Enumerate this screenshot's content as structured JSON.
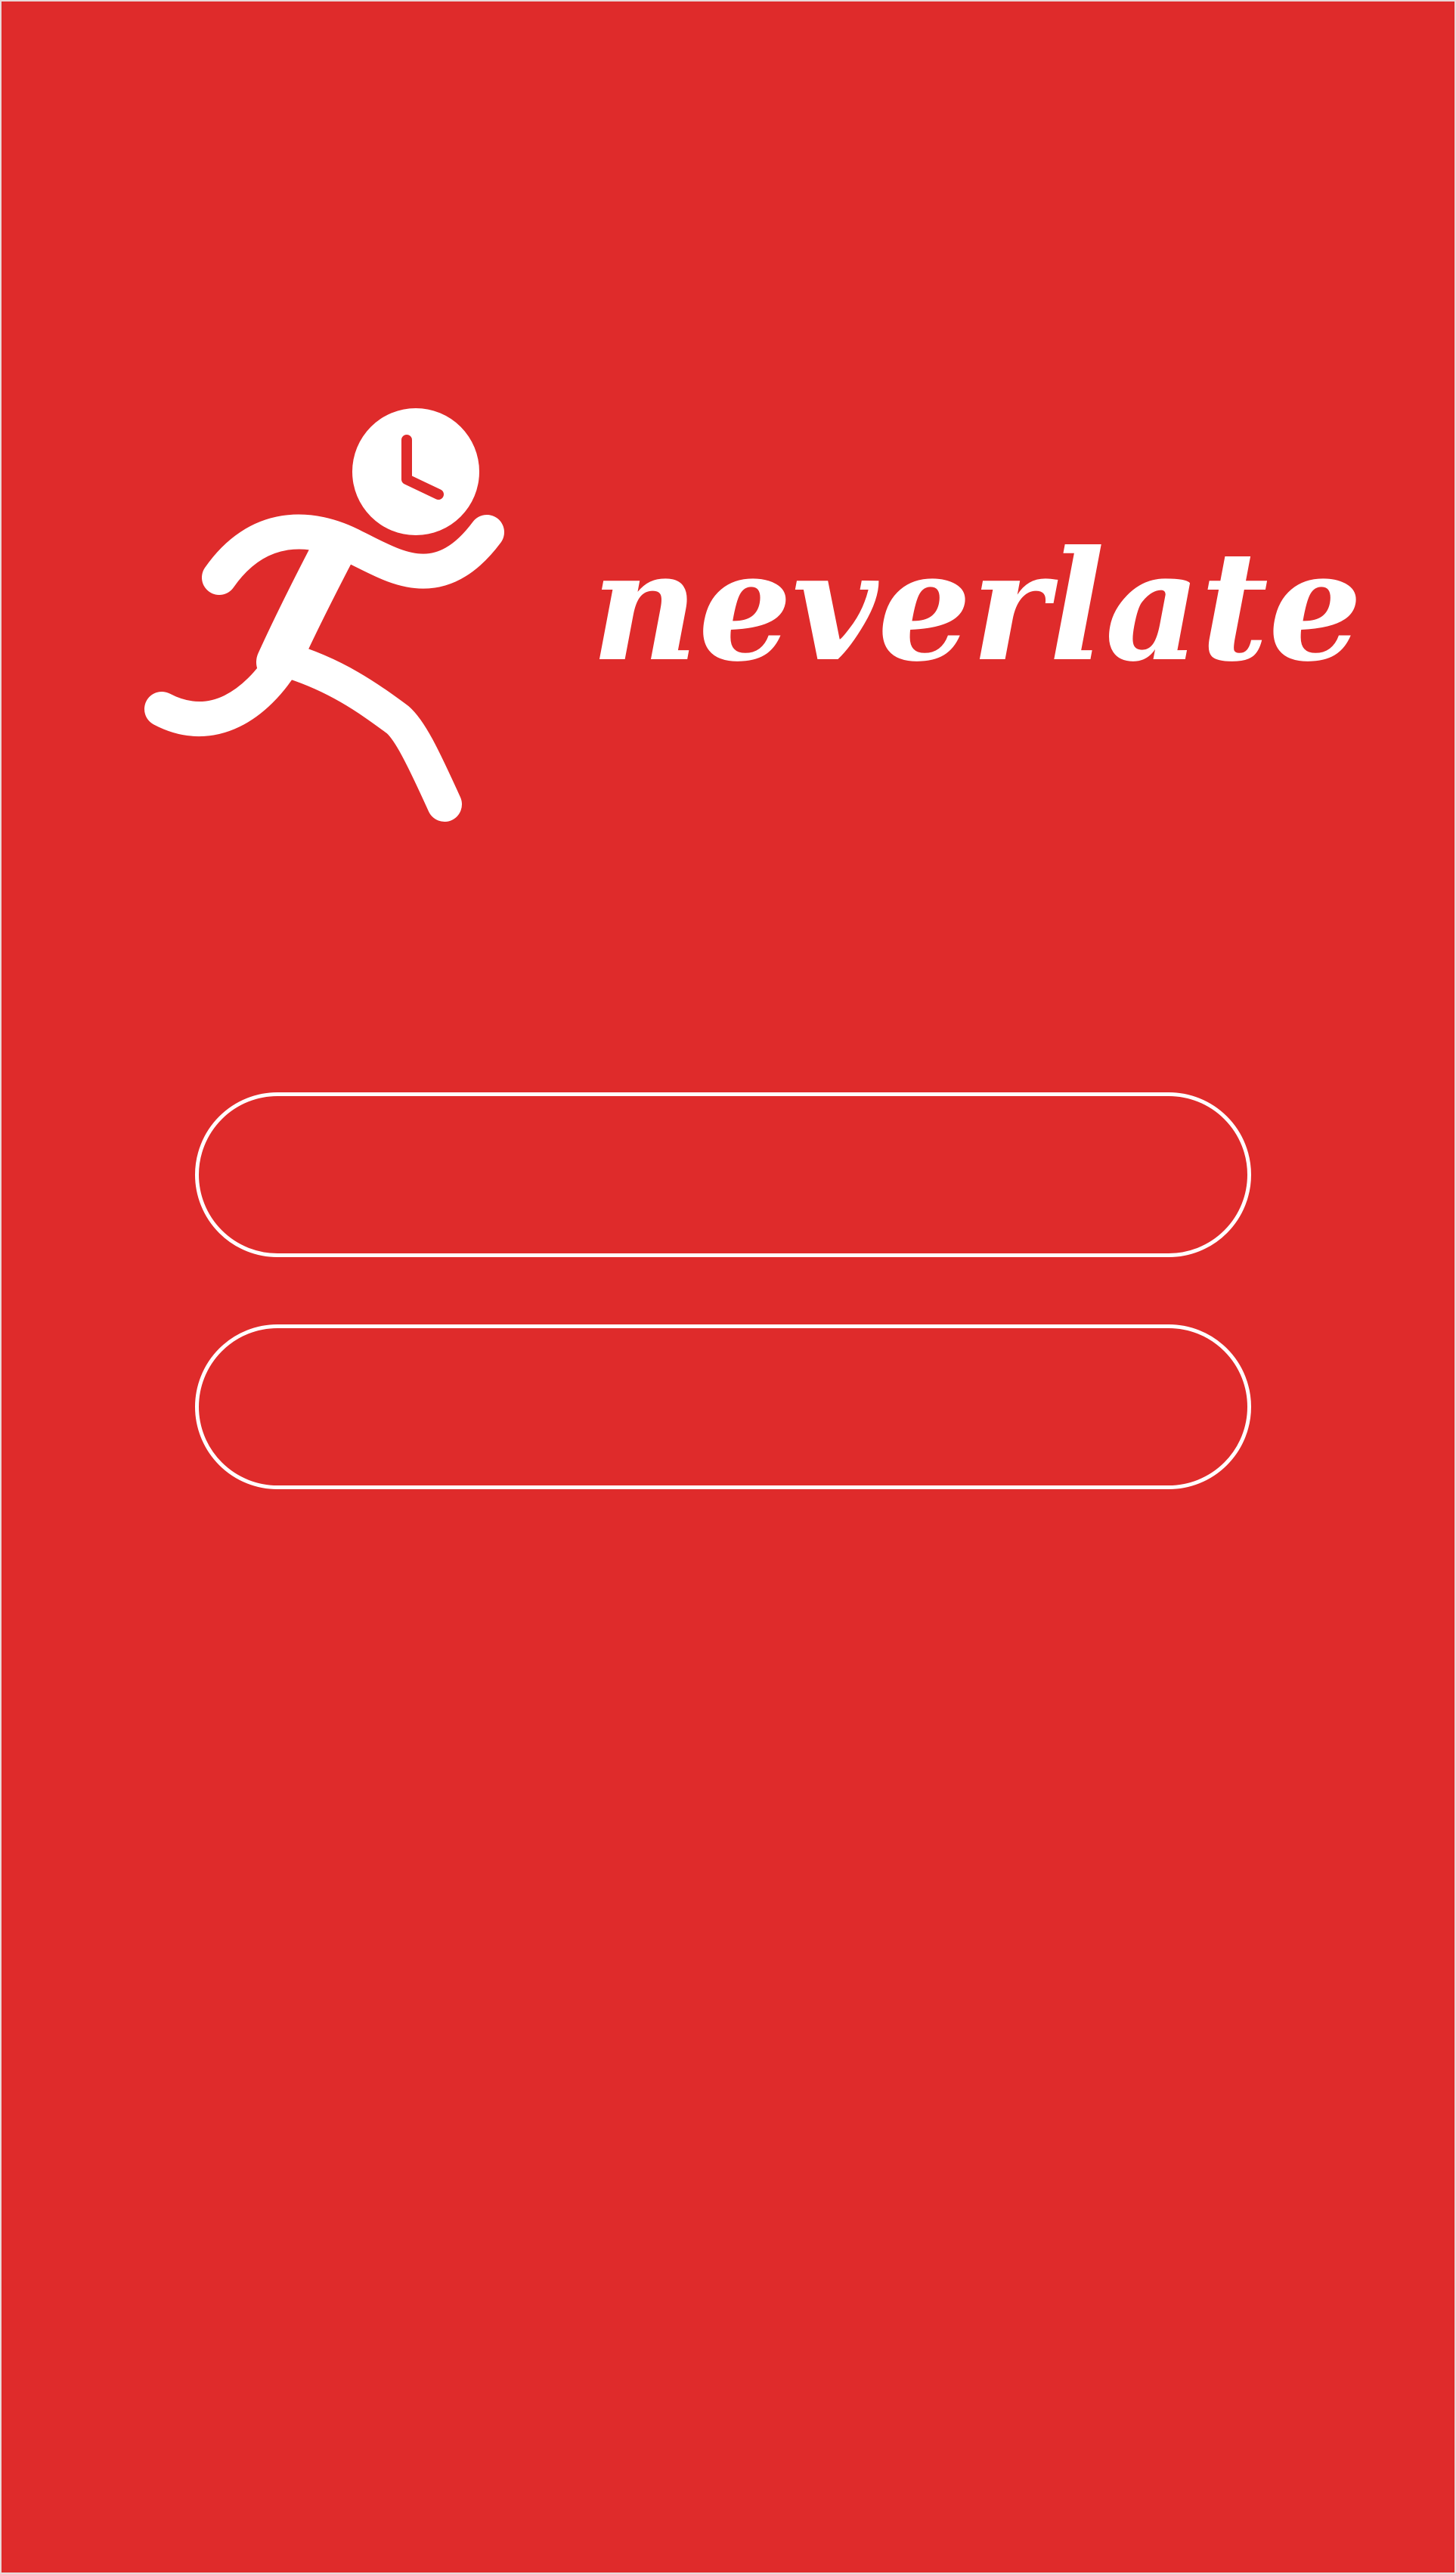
{
  "colors": {
    "background": "#df2b2b",
    "foreground": "#ffffff"
  },
  "brand": {
    "name": "neverlate",
    "logo_icon": "running-person-clock-icon"
  },
  "buttons": [
    {
      "label": ""
    },
    {
      "label": ""
    }
  ]
}
